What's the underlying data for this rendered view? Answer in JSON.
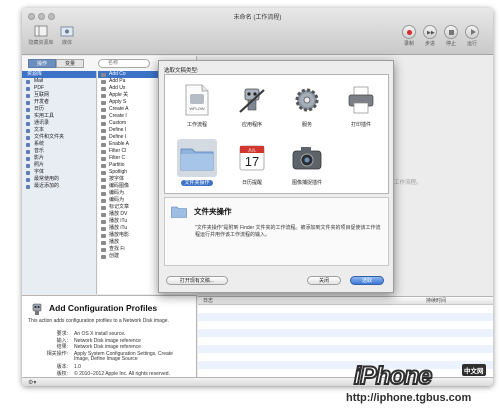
{
  "window": {
    "title": "未命名 (工作流程)",
    "toolbar": {
      "library_label": "隐藏资源库",
      "media_label": "媒体",
      "record_label": "录制",
      "step_label": "步进",
      "stop_label": "停止",
      "run_label": "运行"
    }
  },
  "left_pane": {
    "tabs": [
      "操作",
      "变量"
    ],
    "search_placeholder": "名称",
    "library": [
      {
        "label": "资源库",
        "selected": true
      },
      {
        "label": "Mail"
      },
      {
        "label": "PDF"
      },
      {
        "label": "互联网"
      },
      {
        "label": "开发者"
      },
      {
        "label": "日历"
      },
      {
        "label": "实用工具"
      },
      {
        "label": "通讯录"
      },
      {
        "label": "文本"
      },
      {
        "label": "文件和文件夹"
      },
      {
        "label": "系统"
      },
      {
        "label": "音乐"
      },
      {
        "label": "影片"
      },
      {
        "label": "照片"
      },
      {
        "label": "字体"
      },
      {
        "label": "最常使用的"
      },
      {
        "label": "最近添加的"
      }
    ],
    "actions": [
      {
        "label": "Add Co",
        "selected": true
      },
      {
        "label": "Add Pa"
      },
      {
        "label": "Add Us"
      },
      {
        "label": "Apple 关"
      },
      {
        "label": "Apply S"
      },
      {
        "label": "Create A"
      },
      {
        "label": "Create I"
      },
      {
        "label": "Custom"
      },
      {
        "label": "Define I"
      },
      {
        "label": "Define I"
      },
      {
        "label": "Enable A"
      },
      {
        "label": "Filter Cl"
      },
      {
        "label": "Filter C"
      },
      {
        "label": "Partitio"
      },
      {
        "label": "Spotligh"
      },
      {
        "label": "按字体"
      },
      {
        "label": "编码图像"
      },
      {
        "label": "编码为"
      },
      {
        "label": "编码为"
      },
      {
        "label": "标记文章"
      },
      {
        "label": "播放 DV"
      },
      {
        "label": "播放 iTu"
      },
      {
        "label": "播放 iTu"
      },
      {
        "label": "播放电影"
      },
      {
        "label": "播放"
      },
      {
        "label": "查找 Fi"
      },
      {
        "label": "创建"
      }
    ]
  },
  "description": {
    "title": "Add Configuration Profiles",
    "summary": "This action adds configuration profiles to a Network Disk image.",
    "rows": [
      {
        "key": "要求:",
        "value": "An OS X install source."
      },
      {
        "key": "输入:",
        "value": "Network Disk image reference"
      },
      {
        "key": "结果:",
        "value": "Network Disk image reference"
      },
      {
        "key": "相关操作:",
        "value": "Apply System Configuration Settings, Create"
      },
      {
        "key": "",
        "value": "Image, Define Image Source"
      },
      {
        "key": "版本:",
        "value": "1.0"
      },
      {
        "key": "版权:",
        "value": "© 2010–2012 Apple Inc. All rights reserved."
      }
    ]
  },
  "workflow_area": {
    "ghost_text": "工作流程。",
    "log_columns": [
      "日志",
      "持续时间"
    ]
  },
  "sheet": {
    "label": "选取文稿类型:",
    "templates": [
      {
        "label": "工作流程",
        "icon": "workflow-document-icon"
      },
      {
        "label": "应用程序",
        "icon": "automator-robot-icon"
      },
      {
        "label": "服务",
        "icon": "gear-icon"
      },
      {
        "label": "打印插件",
        "icon": "printer-icon"
      },
      {
        "label": "文件夹操作",
        "icon": "folder-icon",
        "selected": true
      },
      {
        "label": "日历提醒",
        "icon": "calendar-icon",
        "calendar_day": "17",
        "calendar_month": "JUL"
      },
      {
        "label": "图像捕捉插件",
        "icon": "camera-icon"
      }
    ],
    "detail_title": "文件夹操作",
    "detail_text": "\"文件夹操作\"是附到 Finder 文件夹的工作流程。被添加到文件夹的项目促使该工作流程运行并用作该工作流程的输入。",
    "open_button": "打开现有文稿...",
    "close_button": "关闭",
    "choose_button": "选取"
  },
  "watermark": {
    "brand": "iPhone",
    "badge": "中文网",
    "url": "http://iphone.tgbus.com"
  }
}
